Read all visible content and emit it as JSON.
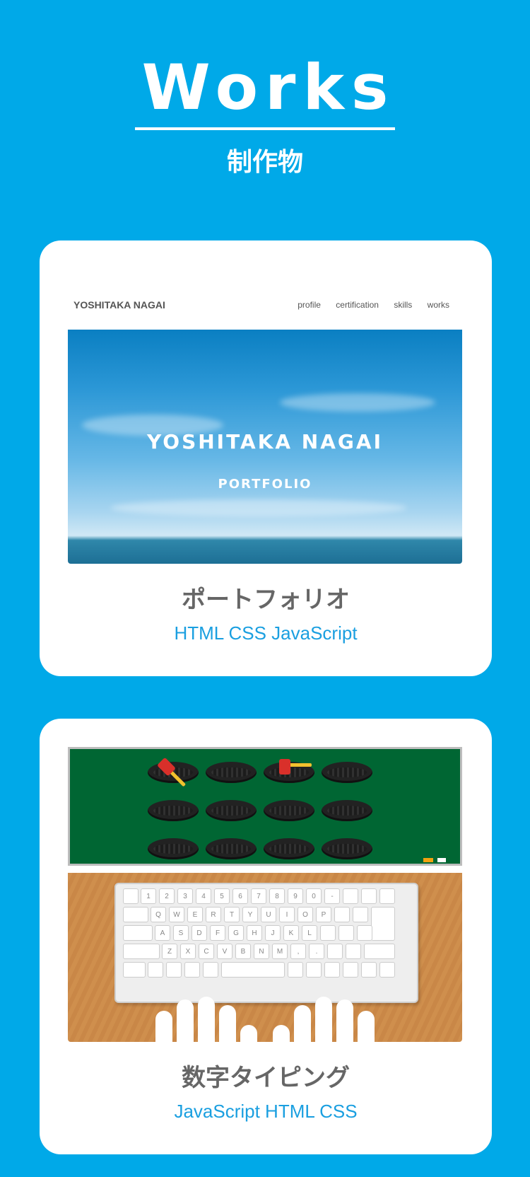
{
  "header": {
    "title": "Works",
    "subtitle": "制作物"
  },
  "works": [
    {
      "title": "ポートフォリオ",
      "tags": "HTML CSS JavaScript",
      "thumbnail": {
        "logo": "YOSHITAKA NAGAI",
        "nav": [
          "profile",
          "certification",
          "skills",
          "works"
        ],
        "hero_title": "YOSHITAKA NAGAI",
        "hero_sub": "PORTFOLIO"
      }
    },
    {
      "title": "数字タイピング",
      "tags": "JavaScript HTML CSS",
      "thumbnail": {
        "keyboard_row1": [
          "1",
          "2",
          "3",
          "4",
          "5",
          "6",
          "7",
          "8",
          "9",
          "0",
          "-"
        ],
        "keyboard_row2": [
          "Q",
          "W",
          "E",
          "R",
          "T",
          "Y",
          "U",
          "I",
          "O",
          "P"
        ],
        "keyboard_row3": [
          "A",
          "S",
          "D",
          "F",
          "G",
          "H",
          "J",
          "K",
          "L"
        ],
        "keyboard_row4": [
          "Z",
          "X",
          "C",
          "V",
          "B",
          "N",
          "M",
          ",",
          "."
        ]
      }
    }
  ],
  "colors": {
    "background": "#00a9e8",
    "tag": "#1a9fe0",
    "card_title": "#666666"
  }
}
